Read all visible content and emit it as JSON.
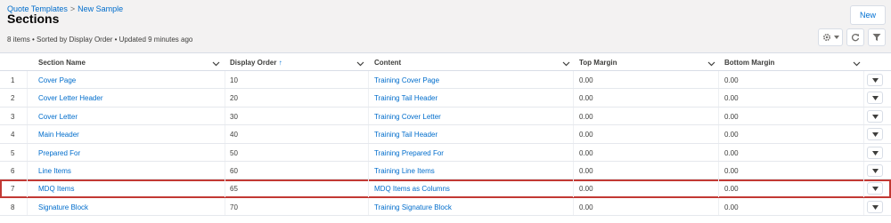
{
  "breadcrumb": {
    "parent": "Quote Templates",
    "separator": ">",
    "current": "New Sample"
  },
  "page_title": "Sections",
  "list_meta": "8 items • Sorted by Display Order • Updated 9 minutes ago",
  "toolbar": {
    "new_label": "New"
  },
  "table": {
    "columns": [
      "Section Name",
      "Display Order",
      "Content",
      "Top Margin",
      "Bottom Margin"
    ],
    "sort_indicator": "↑",
    "rows": [
      {
        "num": "1",
        "name": "Cover Page",
        "order": "10",
        "content": "Training Cover Page",
        "top": "0.00",
        "bottom": "0.00"
      },
      {
        "num": "2",
        "name": "Cover Letter Header",
        "order": "20",
        "content": "Training Tail Header",
        "top": "0.00",
        "bottom": "0.00"
      },
      {
        "num": "3",
        "name": "Cover Letter",
        "order": "30",
        "content": "Training Cover Letter",
        "top": "0.00",
        "bottom": "0.00"
      },
      {
        "num": "4",
        "name": "Main Header",
        "order": "40",
        "content": "Training Tail Header",
        "top": "0.00",
        "bottom": "0.00"
      },
      {
        "num": "5",
        "name": "Prepared For",
        "order": "50",
        "content": "Training Prepared For",
        "top": "0.00",
        "bottom": "0.00"
      },
      {
        "num": "6",
        "name": "Line Items",
        "order": "60",
        "content": "Training Line Items",
        "top": "0.00",
        "bottom": "0.00"
      },
      {
        "num": "7",
        "name": "MDQ Items",
        "order": "65",
        "content": "MDQ Items as Columns",
        "top": "0.00",
        "bottom": "0.00"
      },
      {
        "num": "8",
        "name": "Signature Block",
        "order": "70",
        "content": "Training Signature Block",
        "top": "0.00",
        "bottom": "0.00"
      }
    ]
  },
  "colors": {
    "link": "#006dcc",
    "highlight_border": "#c23934",
    "header_bg": "#f3f2f2"
  },
  "icons": [
    "settings-gear-icon",
    "chevron-down-icon",
    "refresh-icon",
    "filter-icon",
    "row-action-chevron-icon"
  ]
}
